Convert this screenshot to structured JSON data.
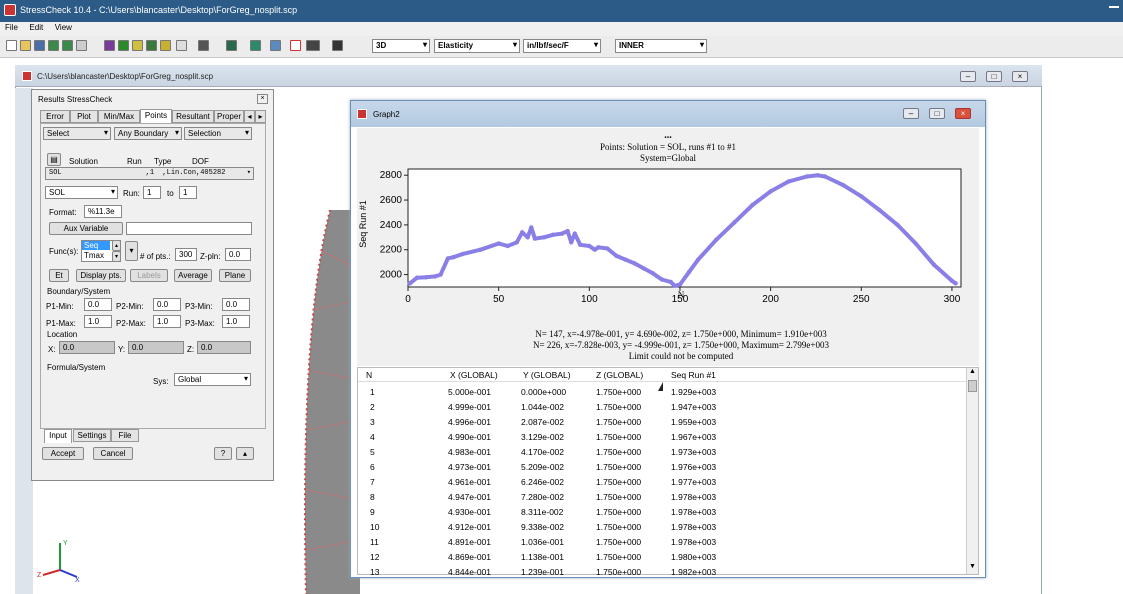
{
  "app": {
    "title": "StressCheck 10.4 - C:\\Users\\blancaster\\Desktop\\ForGreg_nosplit.scp",
    "menu": [
      "File",
      "Edit",
      "View"
    ],
    "toolbar_combos": [
      "3D",
      "Elasticity",
      "in/lbf/sec/F",
      "INNER"
    ]
  },
  "mdi": {
    "title": "C:\\Users\\blancaster\\Desktop\\ForGreg_nosplit.scp"
  },
  "results": {
    "title": "Results StressCheck",
    "tabs": [
      "Error",
      "Plot",
      "Min/Max",
      "Points",
      "Resultant",
      "Proper"
    ],
    "select": "Select",
    "any_boundary": "Any Boundary",
    "selection": "Selection",
    "col_solution": "Solution",
    "col_run": "Run",
    "col_type": "Type",
    "col_dof": "DOF",
    "solution_row": "SOL                    ,1  ,Lin.Con,405282",
    "sol": "SOL",
    "run_label": "Run:",
    "run_from": "1",
    "to_label": "to",
    "run_to": "1",
    "format_label": "Format:",
    "format_value": "%11.3e",
    "aux_variable": "Aux Variable",
    "funcs_label": "Func(s):",
    "func_selected": "Seq",
    "func_next": "Tmax",
    "npts_label": "# of pts.:",
    "npts": "300",
    "zpln_label": "Z-pln:",
    "zpln": "0.0",
    "btn_et": "Et",
    "btn_display": "Display pts.",
    "btn_labels": "Labels",
    "btn_average": "Average",
    "btn_plane": "Plane",
    "boundary_system": "Boundary/System",
    "p1min_label": "P1-Min:",
    "p1min": "0.0",
    "p2min_label": "P2-Min:",
    "p2min": "0.0",
    "p3min_label": "P3-Min:",
    "p3min": "0.0",
    "p1max_label": "P1-Max:",
    "p1max": "1.0",
    "p2max_label": "P2-Max:",
    "p2max": "1.0",
    "p3max_label": "P3-Max:",
    "p3max": "1.0",
    "location": "Location",
    "x_label": "X:",
    "x": "0.0",
    "y_label": "Y:",
    "y": "0.0",
    "z_label": "Z:",
    "z": "0.0",
    "formula_system": "Formula/System",
    "sys_label": "Sys:",
    "sys": "Global",
    "bottom_tabs": [
      "Input",
      "Settings",
      "File"
    ],
    "accept": "Accept",
    "cancel": "Cancel"
  },
  "graph": {
    "title": "Graph2",
    "dots": "...",
    "line1": "Points: Solution = SOL, runs #1 to #1",
    "line2": "System=Global",
    "ylabel": "Seq Run #1",
    "xlabel": "N",
    "info1": "N=   147, x=-4.978e-001, y= 4.690e-002, z= 1.750e+000, Minimum= 1.910e+003",
    "info2": "N=   226, x=-7.828e-003, y= -4.999e-001, z= 1.750e+000, Maximum= 2.799e+003",
    "info3": "Limit could not be computed"
  },
  "chart_data": {
    "type": "line",
    "xlabel": "N",
    "ylabel": "Seq Run #1",
    "xlim": [
      0,
      305
    ],
    "ylim": [
      1900,
      2850
    ],
    "xticks": [
      0,
      50,
      100,
      150,
      200,
      250,
      300
    ],
    "yticks": [
      2000,
      2200,
      2400,
      2600,
      2800
    ],
    "series": [
      {
        "color": "#8a7fe6",
        "x": [
          1,
          5,
          10,
          15,
          18,
          22,
          25,
          30,
          40,
          50,
          55,
          60,
          63,
          66,
          68,
          70,
          75,
          80,
          85,
          88,
          90,
          92,
          95,
          100,
          103,
          105,
          110,
          115,
          120,
          125,
          130,
          135,
          140,
          145,
          147,
          150,
          155,
          160,
          170,
          180,
          190,
          200,
          210,
          220,
          226,
          230,
          240,
          250,
          260,
          270,
          280,
          290,
          300,
          302
        ],
        "y": [
          1929,
          1975,
          1978,
          1985,
          2000,
          2130,
          2140,
          2165,
          2200,
          2250,
          2230,
          2260,
          2340,
          2300,
          2380,
          2290,
          2300,
          2320,
          2330,
          2350,
          2260,
          2330,
          2240,
          2230,
          2200,
          2220,
          2210,
          2150,
          2120,
          2090,
          2050,
          2010,
          1960,
          1940,
          1910,
          1920,
          2020,
          2120,
          2280,
          2420,
          2560,
          2670,
          2750,
          2790,
          2799,
          2790,
          2720,
          2630,
          2520,
          2400,
          2250,
          2080,
          1950,
          1930
        ]
      }
    ]
  },
  "table": {
    "headers": [
      "N",
      "X (GLOBAL)",
      "Y (GLOBAL)",
      "Z (GLOBAL)",
      "Seq Run #1"
    ],
    "rows": [
      [
        "1",
        "5.000e-001",
        "0.000e+000",
        "1.750e+000",
        "1.929e+003"
      ],
      [
        "2",
        "4.999e-001",
        "1.044e-002",
        "1.750e+000",
        "1.947e+003"
      ],
      [
        "3",
        "4.996e-001",
        "2.087e-002",
        "1.750e+000",
        "1.959e+003"
      ],
      [
        "4",
        "4.990e-001",
        "3.129e-002",
        "1.750e+000",
        "1.967e+003"
      ],
      [
        "5",
        "4.983e-001",
        "4.170e-002",
        "1.750e+000",
        "1.973e+003"
      ],
      [
        "6",
        "4.973e-001",
        "5.209e-002",
        "1.750e+000",
        "1.976e+003"
      ],
      [
        "7",
        "4.961e-001",
        "6.246e-002",
        "1.750e+000",
        "1.977e+003"
      ],
      [
        "8",
        "4.947e-001",
        "7.280e-002",
        "1.750e+000",
        "1.978e+003"
      ],
      [
        "9",
        "4.930e-001",
        "8.311e-002",
        "1.750e+000",
        "1.978e+003"
      ],
      [
        "10",
        "4.912e-001",
        "9.338e-002",
        "1.750e+000",
        "1.978e+003"
      ],
      [
        "11",
        "4.891e-001",
        "1.036e-001",
        "1.750e+000",
        "1.978e+003"
      ],
      [
        "12",
        "4.869e-001",
        "1.138e-001",
        "1.750e+000",
        "1.980e+003"
      ],
      [
        "13",
        "4.844e-001",
        "1.239e-001",
        "1.750e+000",
        "1.982e+003"
      ]
    ]
  },
  "colors": {
    "accent": "#2b5b86",
    "series": "#8a7fe6",
    "panel": "#f0f0f0"
  }
}
